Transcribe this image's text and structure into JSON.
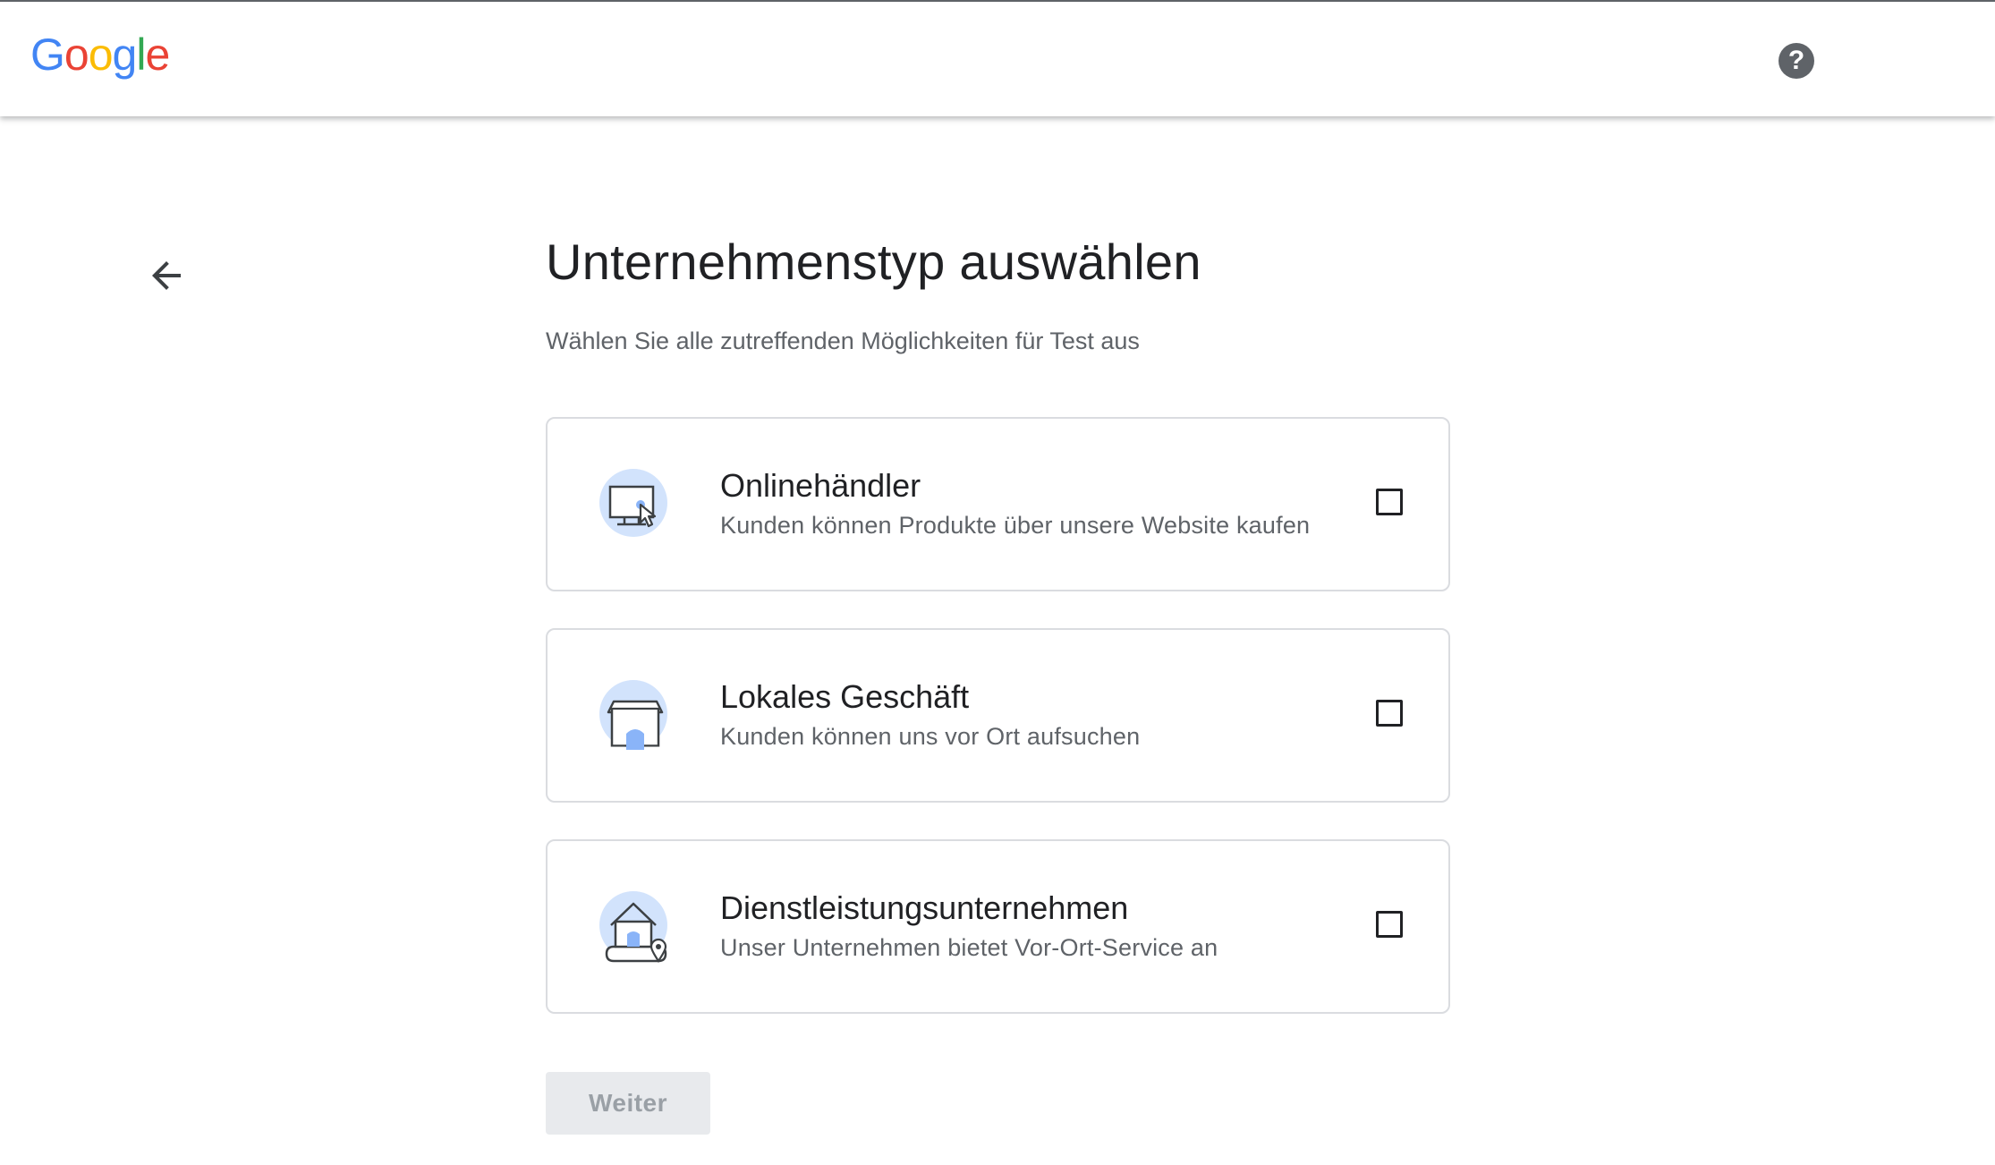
{
  "header": {
    "logo_letters": [
      {
        "char": "G",
        "color": "#4285F4"
      },
      {
        "char": "o",
        "color": "#EA4335"
      },
      {
        "char": "o",
        "color": "#FBBC05"
      },
      {
        "char": "g",
        "color": "#4285F4"
      },
      {
        "char": "l",
        "color": "#34A853"
      },
      {
        "char": "e",
        "color": "#EA4335"
      }
    ],
    "help_icon": "help-circle-icon",
    "help_glyph": "?"
  },
  "page": {
    "back_icon": "arrow-back-icon",
    "title": "Unternehmenstyp auswählen",
    "subtitle": "Wählen Sie alle zutreffenden Möglichkeiten für Test aus"
  },
  "options": [
    {
      "icon": "monitor-cursor-icon",
      "name": "Onlinehändler",
      "description": "Kunden können Produkte über unsere Website kaufen",
      "checked": false
    },
    {
      "icon": "storefront-icon",
      "name": "Lokales Geschäft",
      "description": "Kunden können uns vor Ort aufsuchen",
      "checked": false
    },
    {
      "icon": "house-location-icon",
      "name": "Dienstleistungsunternehmen",
      "description": "Unser Unternehmen bietet Vor-Ort-Service an",
      "checked": false
    }
  ],
  "footer": {
    "next_label": "Weiter",
    "next_disabled": true
  },
  "colors": {
    "icon_circle": "#d2e3fc",
    "border": "#dadce0",
    "text_secondary": "#5f6368"
  }
}
